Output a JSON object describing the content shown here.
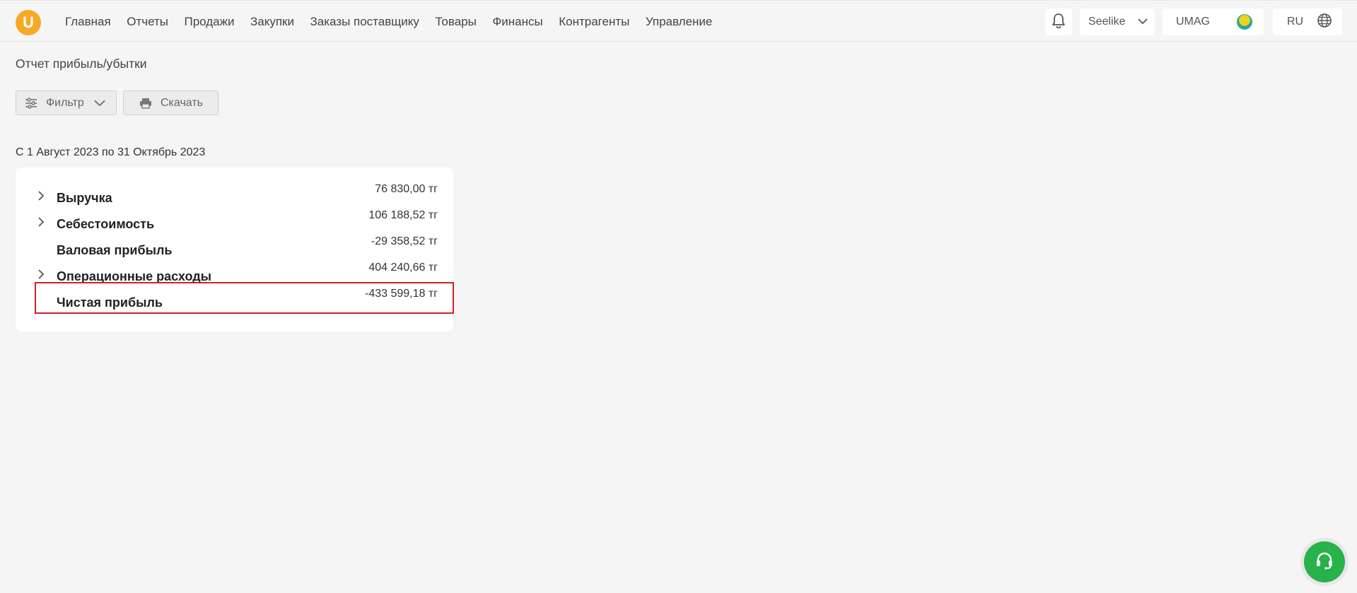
{
  "nav": {
    "items": [
      "Главная",
      "Отчеты",
      "Продажи",
      "Закупки",
      "Заказы поставщику",
      "Товары",
      "Финансы",
      "Контрагенты",
      "Управление"
    ]
  },
  "header": {
    "company": "Seelike",
    "shop": "UMAG",
    "language": "RU"
  },
  "page": {
    "title": "Отчет прибыль/убытки",
    "period": "С 1 Август 2023 по 31 Октябрь 2023"
  },
  "toolbar": {
    "filter_label": "Фильтр",
    "download_label": "Скачать"
  },
  "report": {
    "rows": [
      {
        "label": "Выручка",
        "value": "76 830,00 тг",
        "expandable": true
      },
      {
        "label": "Себестоимость",
        "value": "106 188,52 тг",
        "expandable": true
      },
      {
        "label": "Валовая прибыль",
        "value": "-29 358,52 тг",
        "expandable": false
      },
      {
        "label": "Операционные расходы",
        "value": "404 240,66 тг",
        "expandable": true
      },
      {
        "label": "Чистая прибыль",
        "value": "-433 599,18 тг",
        "expandable": false
      }
    ]
  },
  "colors": {
    "brand": "#f7a825",
    "highlight": "#d32027",
    "support": "#27b24a"
  },
  "icons": [
    "logo-icon",
    "bell-icon",
    "chevron-down-icon",
    "globe-icon",
    "filter-icon",
    "printer-icon",
    "chevron-right-icon",
    "headset-icon"
  ]
}
